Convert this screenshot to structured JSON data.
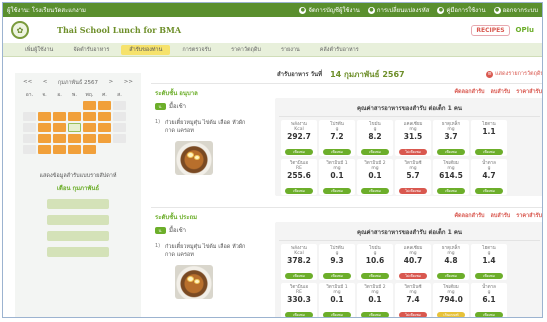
{
  "topbar": {
    "user": "ผู้ใช้งาน: โรงเรียนวัดสะแกงาม",
    "links": [
      {
        "label": "จัดการบัญชีผู้ใช้งาน",
        "icon": "user-icon"
      },
      {
        "label": "การเปลี่ยนแปลงรหัส",
        "icon": "key-icon"
      },
      {
        "label": "คู่มือการใช้งาน",
        "icon": "book-icon"
      },
      {
        "label": "ออกจากระบบ",
        "icon": "logout-icon"
      }
    ]
  },
  "header": {
    "title": "Thai School Lunch for BMA",
    "brand_recipes": "RECIPES",
    "brand_other_prefix": "O",
    "brand_other_suffix": "Plu"
  },
  "nav": {
    "tabs": [
      "เพิ่มผู้ใช้งาน",
      "จัดตำรับอาหาร",
      "สำรับของท่าน",
      "การตรวจรับ",
      "ราคาวัตถุดิบ",
      "รายงาน",
      "คลังตำรับอาหาร"
    ],
    "active_index": 2
  },
  "calendar": {
    "prev": "<<",
    "prev_single": "<",
    "month": "กุมภาพันธ์ 2567",
    "next_single": ">",
    "next": ">>",
    "weekdays": [
      "อา.",
      "จ.",
      "อ.",
      "พ.",
      "พฤ.",
      "ศ.",
      "ส."
    ]
  },
  "report": {
    "title": "แสดงข้อมูลสำรับแบบรายสัปดาห์",
    "month_label": "เดือน",
    "month_value": "กุมภาพันธ์"
  },
  "date": {
    "label": "สำรับอาหาร วันที่",
    "value": "14 กุมภาพันธ์ 2567",
    "edit": "แสดงรายการวัตถุดิบ"
  },
  "nutrition_title": "คุณค่าสารอาหารของสำรับ ต่อเด็ก 1 คน",
  "card_actions": [
    "คัดลอกสำรับ",
    "ลบสำรับ",
    "ราคาสำรับ"
  ],
  "cards": [
    {
      "level_label": "ระดับชั้น",
      "level_value": "อนุบาล",
      "meal_icon": "บ.",
      "meal": "มื้อเช้า",
      "dish_no": "1)",
      "dish_name": "ก๋วยเตี๋ยวหมูตุ๋น ไข่ต้ม เลือด หัวผักกาด แครอท",
      "nutrients": [
        {
          "label": "พลังงาน",
          "unit": "Kcal",
          "value": "292.7",
          "status": "ok",
          "status_text": "เพียงพอ"
        },
        {
          "label": "โปรตีน",
          "unit": "g",
          "value": "7.2",
          "status": "ok",
          "status_text": "เพียงพอ"
        },
        {
          "label": "ไขมัน",
          "unit": "g",
          "value": "8.2",
          "status": "ok",
          "status_text": "เพียงพอ"
        },
        {
          "label": "แคลเซียม",
          "unit": "mg",
          "value": "31.5",
          "status": "hi",
          "status_text": "ไม่เพียงพอ"
        },
        {
          "label": "ธาตุเหล็ก",
          "unit": "mg",
          "value": "3.7",
          "status": "ok",
          "status_text": "เพียงพอ"
        },
        {
          "label": "ไฮดาน",
          "unit": "",
          "value": "1.1",
          "status": "ok",
          "status_text": "เพียงพอ"
        },
        {
          "label": "วิตามินเอ",
          "unit": "RE",
          "value": "255.6",
          "status": "ok",
          "status_text": "เพียงพอ"
        },
        {
          "label": "วิตามินบี 1",
          "unit": "mg",
          "value": "0.1",
          "status": "ok",
          "status_text": "เพียงพอ"
        },
        {
          "label": "วิตามินบี 2",
          "unit": "mg",
          "value": "0.1",
          "status": "ok",
          "status_text": "เพียงพอ"
        },
        {
          "label": "วิตามินซี",
          "unit": "mg",
          "value": "5.7",
          "status": "hi",
          "status_text": "ไม่เพียงพอ"
        },
        {
          "label": "โซเดียม",
          "unit": "mg",
          "value": "614.5",
          "status": "ok",
          "status_text": "เพียงพอ"
        },
        {
          "label": "น้ำตาล",
          "unit": "g",
          "value": "4.7",
          "status": "ok",
          "status_text": "เพียงพอ"
        }
      ]
    },
    {
      "level_label": "ระดับชั้น",
      "level_value": "ประถม",
      "meal_icon": "บ.",
      "meal": "มื้อเช้า",
      "dish_no": "1)",
      "dish_name": "ก๋วยเตี๋ยวหมูตุ๋น ไข่ต้ม เลือด หัวผักกาด แครอท",
      "nutrients": [
        {
          "label": "พลังงาน",
          "unit": "Kcal",
          "value": "378.2",
          "status": "ok",
          "status_text": "เพียงพอ"
        },
        {
          "label": "โปรตีน",
          "unit": "g",
          "value": "9.3",
          "status": "ok",
          "status_text": "เพียงพอ"
        },
        {
          "label": "ไขมัน",
          "unit": "g",
          "value": "10.6",
          "status": "ok",
          "status_text": "เพียงพอ"
        },
        {
          "label": "แคลเซียม",
          "unit": "mg",
          "value": "40.7",
          "status": "hi",
          "status_text": "ไม่เพียงพอ"
        },
        {
          "label": "ธาตุเหล็ก",
          "unit": "mg",
          "value": "4.8",
          "status": "ok",
          "status_text": "เพียงพอ"
        },
        {
          "label": "ไฮดาน",
          "unit": "g",
          "value": "1.4",
          "status": "ok",
          "status_text": "เพียงพอ"
        },
        {
          "label": "วิตามินเอ",
          "unit": "RE",
          "value": "330.3",
          "status": "ok",
          "status_text": "เพียงพอ"
        },
        {
          "label": "วิตามินบี 1",
          "unit": "mg",
          "value": "0.1",
          "status": "ok",
          "status_text": "เพียงพอ"
        },
        {
          "label": "วิตามินบี 2",
          "unit": "mg",
          "value": "0.1",
          "status": "ok",
          "status_text": "เพียงพอ"
        },
        {
          "label": "วิตามินซี",
          "unit": "mg",
          "value": "7.4",
          "status": "hi",
          "status_text": "ไม่เพียงพอ"
        },
        {
          "label": "โซเดียม",
          "unit": "mg",
          "value": "794.0",
          "status": "lo",
          "status_text": "เกินเกณฑ์"
        },
        {
          "label": "น้ำตาล",
          "unit": "g",
          "value": "6.1",
          "status": "ok",
          "status_text": "เพียงพอ"
        }
      ]
    }
  ]
}
